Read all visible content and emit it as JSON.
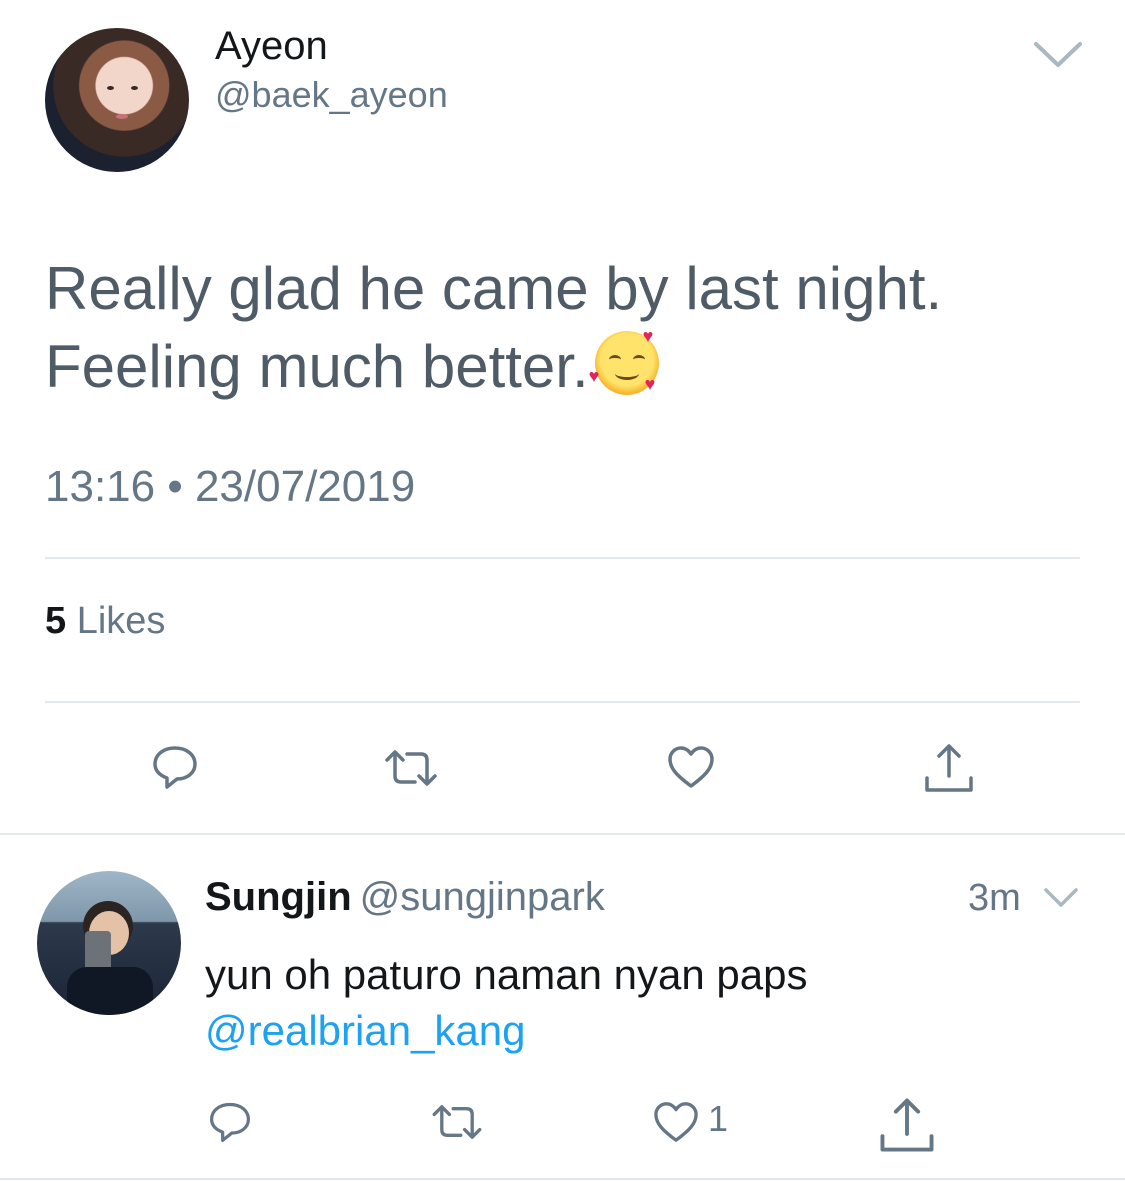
{
  "main_tweet": {
    "display_name": "Ayeon",
    "handle": "@baek_ayeon",
    "text_line1": "Really glad he came by last night.",
    "text_line2": "Feeling much better.",
    "emoji": "smiling-face-with-hearts",
    "timestamp": "13:16 • 23/07/2019",
    "likes_count": "5",
    "likes_label": "Likes"
  },
  "reply": {
    "display_name": "Sungjin",
    "handle": "@sungjinpark",
    "time": "3m",
    "text": "yun oh paturo naman nyan paps",
    "mention": "@realbrian_kang",
    "like_count": "1"
  },
  "colors": {
    "primary_text": "#14171a",
    "secondary_text": "#657786",
    "link": "#1da1f2",
    "divider": "#e1e8ed"
  },
  "icons": [
    "chevron-down-icon",
    "reply-icon",
    "retweet-icon",
    "like-icon",
    "share-icon"
  ]
}
